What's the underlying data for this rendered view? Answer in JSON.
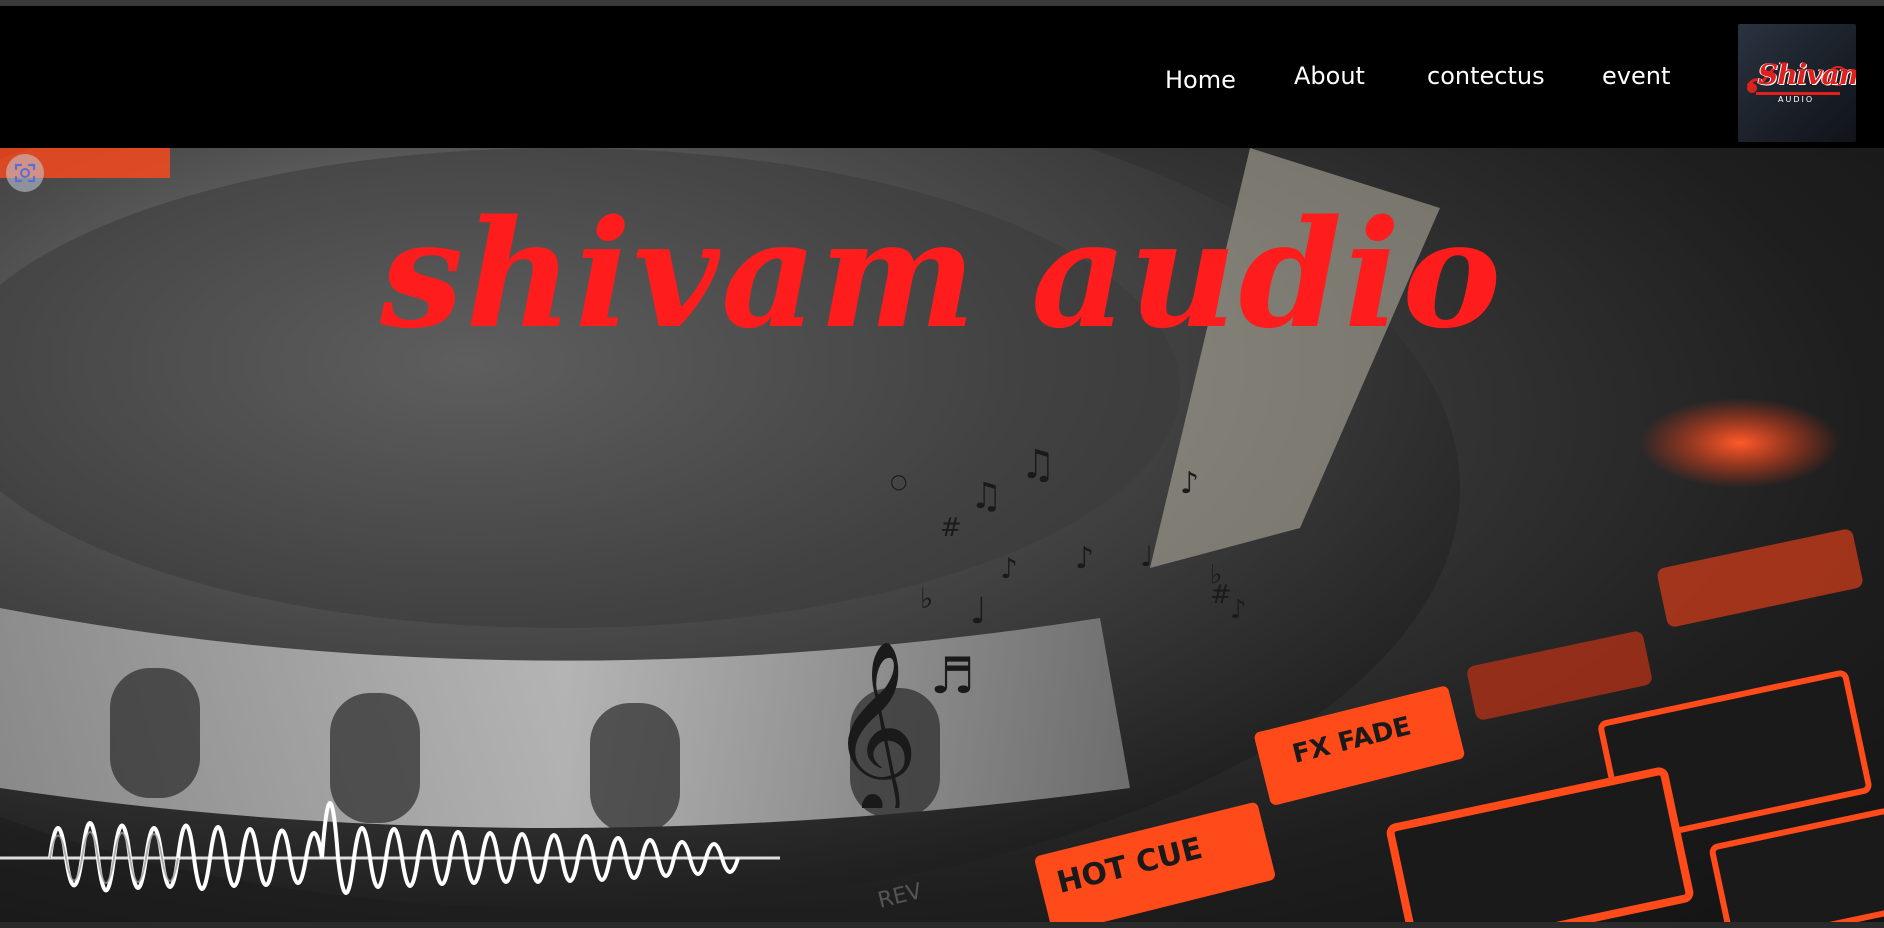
{
  "nav": {
    "links": [
      "Home",
      "About",
      "contectus",
      "event"
    ]
  },
  "logo": {
    "text": "Shivam",
    "subtext": "AUDIO"
  },
  "hero": {
    "title": "shivam audio"
  },
  "colors": {
    "accent": "#ff1c1c",
    "navbar_bg": "#000000",
    "nav_text": "#ffffff"
  },
  "icons": [
    "scan-icon",
    "music-notes-icon",
    "treble-clef-icon",
    "soundwave-icon"
  ]
}
